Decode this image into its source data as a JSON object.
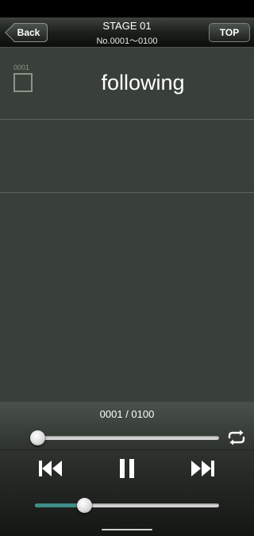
{
  "header": {
    "title": "STAGE 01",
    "subtitle": "No.0001〜0100",
    "back_label": "Back",
    "top_label": "TOP"
  },
  "card": {
    "number": "0001",
    "word": "following",
    "checked": false
  },
  "player": {
    "counter": "0001 / 0100",
    "progress": 0.0,
    "speed_level": 0.27,
    "icons": {
      "repeat": "repeat-icon",
      "prev": "skip-previous-icon",
      "pause": "pause-icon",
      "next": "skip-next-icon"
    },
    "speed_color": "#3e8e87"
  },
  "colors": {
    "background": "#394039",
    "accent": "#3e8e87"
  }
}
